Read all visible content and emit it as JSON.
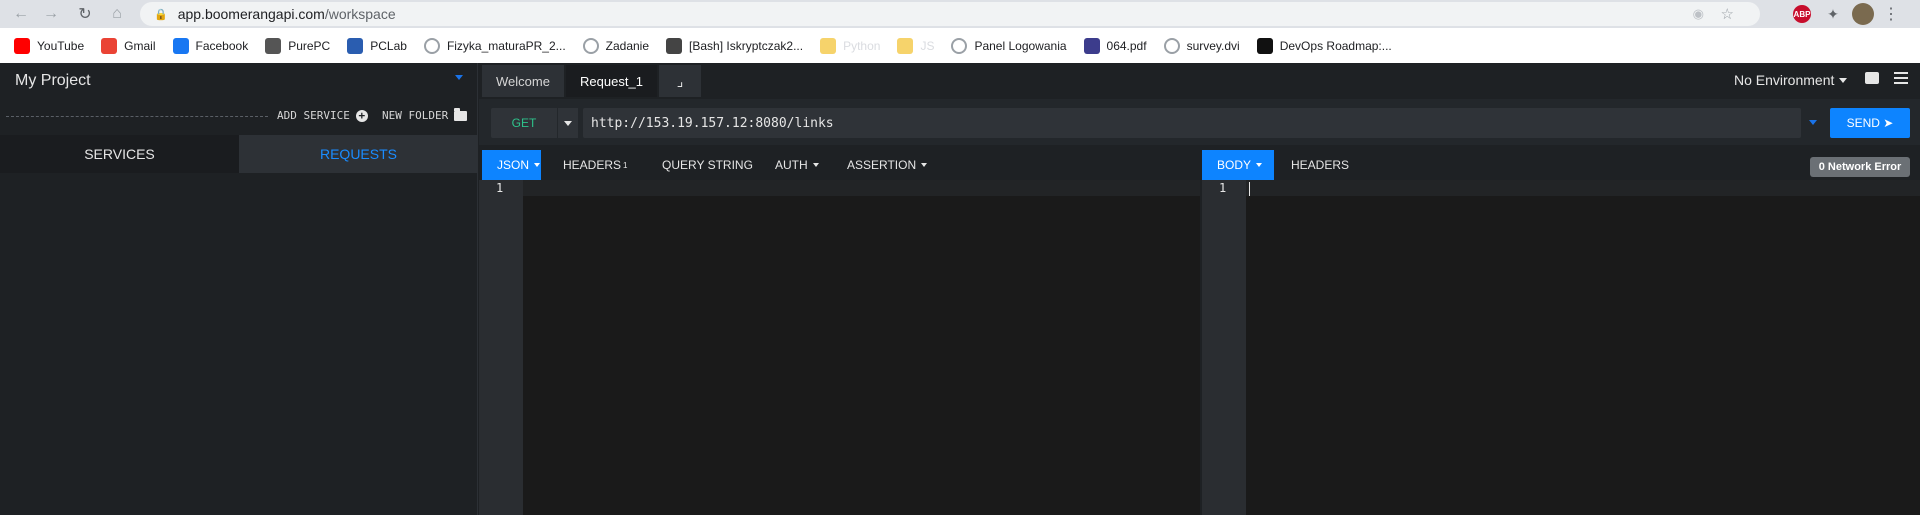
{
  "browser": {
    "url_host": "app.boomerangapi.com",
    "url_path": "/workspace",
    "abp_label": "ABP"
  },
  "bookmarks": [
    {
      "label": "YouTube",
      "icon": "youtube-icon",
      "color": "#ff0000"
    },
    {
      "label": "Gmail",
      "icon": "gmail-icon",
      "color": "#ea4335"
    },
    {
      "label": "Facebook",
      "icon": "facebook-icon",
      "color": "#1877f2"
    },
    {
      "label": "PurePC",
      "icon": "purepc-icon",
      "color": "#555555"
    },
    {
      "label": "PCLab",
      "icon": "pclab-icon",
      "color": "#2a5db0"
    },
    {
      "label": "Fizyka_maturaPR_2...",
      "icon": "globe-icon",
      "color": "#9aa0a6"
    },
    {
      "label": "Zadanie",
      "icon": "globe-icon",
      "color": "#9aa0a6"
    },
    {
      "label": "[Bash] Iskryptczak2...",
      "icon": "terminal-icon",
      "color": "#444444"
    },
    {
      "label": "Python",
      "icon": "folder-icon",
      "color": "#f6d36b"
    },
    {
      "label": "JS",
      "icon": "folder-icon",
      "color": "#f6d36b"
    },
    {
      "label": "Panel Logowania",
      "icon": "globe-icon",
      "color": "#9aa0a6"
    },
    {
      "label": "064.pdf",
      "icon": "pdf-icon",
      "color": "#3c3c8c"
    },
    {
      "label": "survey.dvi",
      "icon": "globe-icon",
      "color": "#9aa0a6"
    },
    {
      "label": "DevOps Roadmap:...",
      "icon": "roadmap-icon",
      "color": "#111111"
    }
  ],
  "sidebar": {
    "project_title": "My Project",
    "add_service_label": "ADD SERVICE",
    "new_folder_label": "NEW FOLDER",
    "tabs": [
      {
        "label": "SERVICES"
      },
      {
        "label": "REQUESTS"
      }
    ]
  },
  "tabs": [
    {
      "label": "Welcome"
    },
    {
      "label": "Request_1"
    }
  ],
  "environment": {
    "label": "No Environment"
  },
  "request": {
    "method": "GET",
    "url": "http://153.19.157.12:8080/links",
    "send_label": "SEND ➤"
  },
  "request_panel": {
    "tabs": [
      {
        "label": "JSON"
      },
      {
        "label": "HEADERS"
      },
      {
        "label": "QUERY STRING"
      },
      {
        "label": "AUTH"
      },
      {
        "label": "ASSERTION"
      }
    ],
    "headers_count": "1",
    "line_number": "1"
  },
  "response_panel": {
    "tabs": [
      {
        "label": "BODY"
      },
      {
        "label": "HEADERS"
      }
    ],
    "line_number": "1",
    "status_badge": "0 Network Error"
  },
  "colors": {
    "accent": "#0d84ff",
    "method_get": "#2ec28b"
  }
}
